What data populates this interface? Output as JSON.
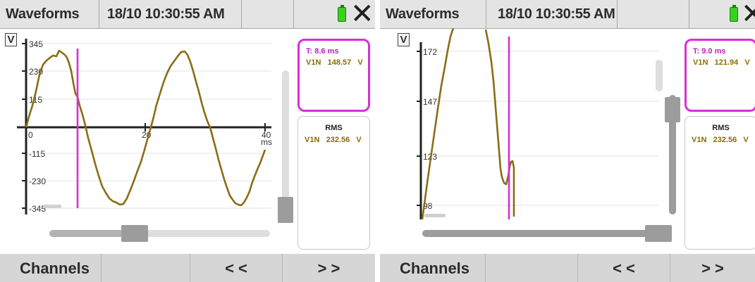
{
  "screens": [
    {
      "title": "Waveforms",
      "datetime": "18/10 10:30:55 AM",
      "unit": "V",
      "y_ticks": [
        "345",
        "230",
        "115",
        "0",
        "-115",
        "-230",
        "-345"
      ],
      "x_ticks": [
        "20",
        "40"
      ],
      "x_unit": "ms",
      "cursor": {
        "time": "T:  8.6 ms",
        "channel": "V1N",
        "value": "148.57",
        "unit": "V"
      },
      "rms": {
        "title": "RMS",
        "channel": "V1N",
        "value": "232.56",
        "unit": "V"
      },
      "trace_color": "#8a6d14",
      "cursor_color": "#d72fd7",
      "footer": {
        "channels": "Channels",
        "prev": "< <",
        "next": "> >"
      },
      "scroll_h_position": 0.45,
      "scroll_v_position": 0.95
    },
    {
      "title": "Waveforms",
      "datetime": "18/10 10:30:55 AM",
      "unit": "V",
      "y_ticks": [
        "172",
        "147",
        "123",
        "98"
      ],
      "cursor": {
        "time": "T:  9.0 ms",
        "channel": "V1N",
        "value": "121.94",
        "unit": "V"
      },
      "rms": {
        "title": "RMS",
        "channel": "V1N",
        "value": "232.56",
        "unit": "V"
      },
      "trace_color": "#8a6d14",
      "cursor_color": "#d72fd7",
      "footer": {
        "channels": "Channels",
        "prev": "< <",
        "next": "> >"
      },
      "scroll_h_position": 1.0,
      "scroll_v_position": 0.3
    }
  ]
}
